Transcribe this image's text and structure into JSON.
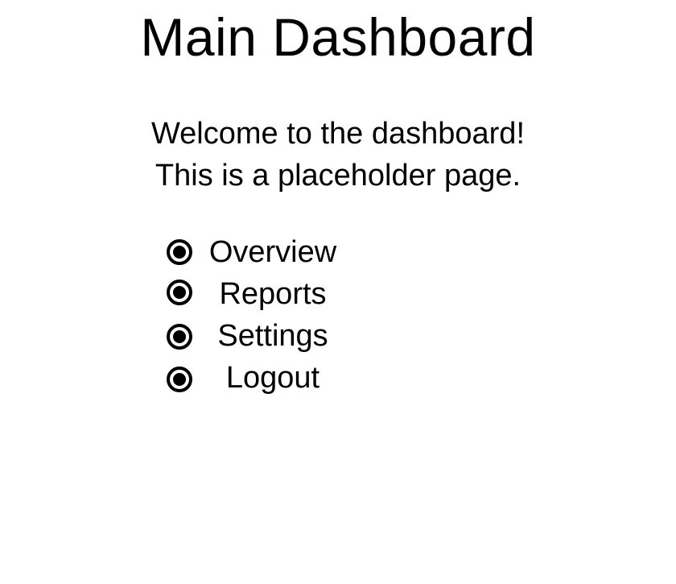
{
  "header": {
    "title": "Main Dashboard"
  },
  "intro": {
    "line1": "Welcome to the dashboard!",
    "line2": "This is a placeholder page."
  },
  "menu": {
    "items": [
      {
        "label": "Overview",
        "icon": "radio-selected-icon"
      },
      {
        "label": "Reports",
        "icon": "radio-selected-icon"
      },
      {
        "label": "Settings",
        "icon": "radio-selected-icon"
      },
      {
        "label": "Logout",
        "icon": "radio-selected-icon"
      }
    ]
  }
}
